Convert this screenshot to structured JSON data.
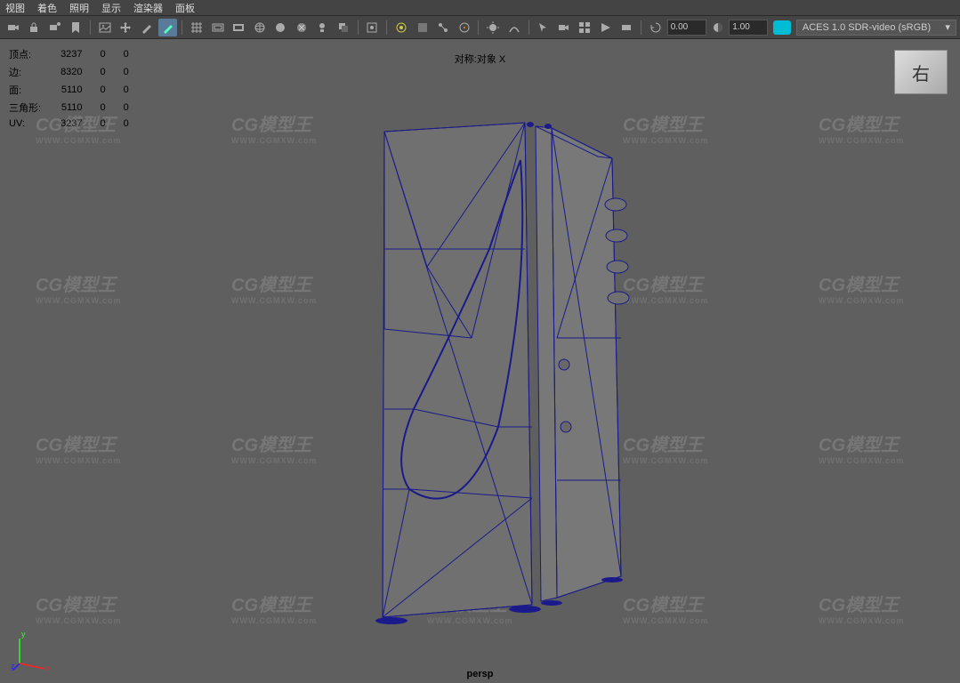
{
  "menubar": {
    "items": [
      "视图",
      "着色",
      "照明",
      "显示",
      "渲染器",
      "面板"
    ]
  },
  "toolbar": {
    "spin_value": "0.00",
    "opacity_value": "1.00",
    "colorspace": "ACES 1.0 SDR-video (sRGB)"
  },
  "viewport": {
    "symmetry_label": "对称:对象 X",
    "camera_label": "persp",
    "viewcube_face": "右",
    "stats": {
      "rows": [
        {
          "label": "顶点:",
          "v1": "3237",
          "v2": "0",
          "v3": "0"
        },
        {
          "label": "边:",
          "v1": "8320",
          "v2": "0",
          "v3": "0"
        },
        {
          "label": "面:",
          "v1": "5110",
          "v2": "0",
          "v3": "0"
        },
        {
          "label": "三角形:",
          "v1": "5110",
          "v2": "0",
          "v3": "0"
        },
        {
          "label": "UV:",
          "v1": "3237",
          "v2": "0",
          "v3": "0"
        }
      ]
    },
    "axis": {
      "x": "x",
      "y": "y",
      "z": "z"
    }
  },
  "watermark": {
    "text": "CG模型王",
    "sub": "WWW.CGMXW.com"
  }
}
